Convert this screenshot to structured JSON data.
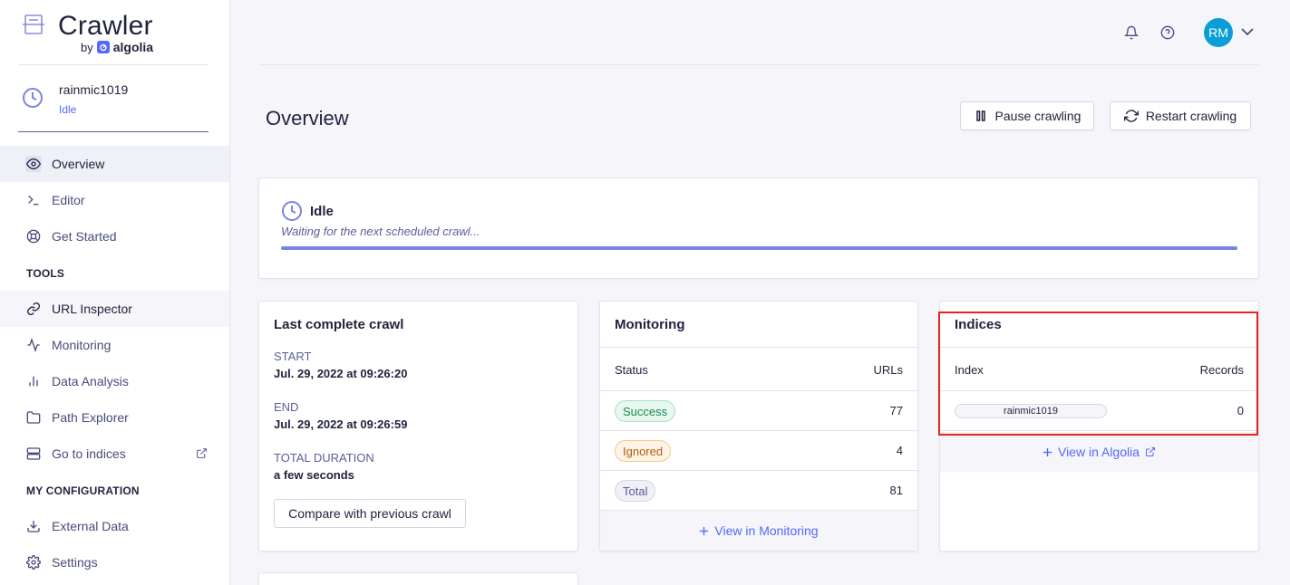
{
  "brand": {
    "title": "Crawler",
    "by": "by",
    "algolia": "algolia"
  },
  "crawler": {
    "name": "rainmic1019",
    "status": "Idle"
  },
  "sidebar": {
    "items": [
      {
        "label": "Overview",
        "icon": "eye-icon"
      },
      {
        "label": "Editor",
        "icon": "terminal-icon"
      },
      {
        "label": "Get Started",
        "icon": "lifebuoy-icon"
      }
    ],
    "tools_label": "TOOLS",
    "tools": [
      {
        "label": "URL Inspector",
        "icon": "link-icon"
      },
      {
        "label": "Monitoring",
        "icon": "activity-icon"
      },
      {
        "label": "Data Analysis",
        "icon": "bar-chart-icon"
      },
      {
        "label": "Path Explorer",
        "icon": "folder-icon"
      },
      {
        "label": "Go to indices",
        "icon": "server-icon"
      }
    ],
    "config_label": "MY CONFIGURATION",
    "config": [
      {
        "label": "External Data",
        "icon": "download-icon"
      },
      {
        "label": "Settings",
        "icon": "gear-icon"
      }
    ]
  },
  "header": {
    "avatar_initials": "RM"
  },
  "page": {
    "title": "Overview"
  },
  "actions": {
    "pause": "Pause crawling",
    "restart": "Restart crawling"
  },
  "status_card": {
    "title": "Idle",
    "subtitle": "Waiting for the next scheduled crawl...",
    "progress": 1.0
  },
  "last_crawl": {
    "title": "Last complete crawl",
    "start_label": "START",
    "start_value": "Jul. 29, 2022 at 09:26:20",
    "end_label": "END",
    "end_value": "Jul. 29, 2022 at 09:26:59",
    "duration_label": "TOTAL DURATION",
    "duration_value": "a few seconds",
    "compare_button": "Compare with previous crawl"
  },
  "monitoring": {
    "title": "Monitoring",
    "col_status": "Status",
    "col_urls": "URLs",
    "rows": [
      {
        "status": "Success",
        "urls": "77"
      },
      {
        "status": "Ignored",
        "urls": "4"
      },
      {
        "status": "Total",
        "urls": "81"
      }
    ],
    "footer_link": "View in Monitoring"
  },
  "indices": {
    "title": "Indices",
    "col_index": "Index",
    "col_records": "Records",
    "rows": [
      {
        "index": "rainmic1019",
        "records": "0"
      }
    ],
    "footer_link": "View in Algolia"
  },
  "colors": {
    "accent": "#5468ff",
    "avatar": "#0a9ed8",
    "highlight": "#e8231d",
    "progress": "#7b83e4"
  }
}
